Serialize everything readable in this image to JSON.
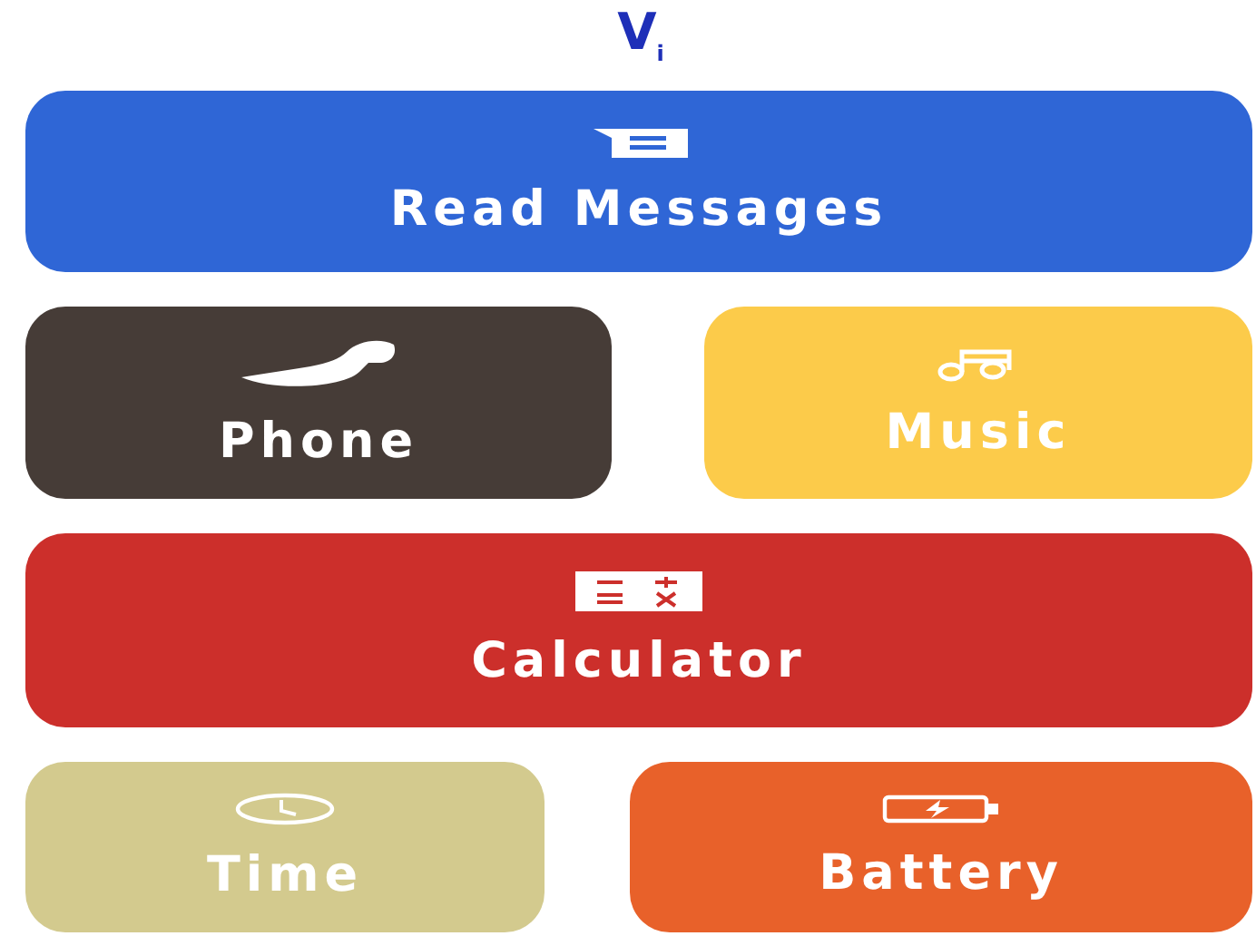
{
  "logo": "V$_{i}$",
  "rows": [
    {
      "tiles": [
        {
          "label": "Read Messages",
          "color": "#2f66d6",
          "kind": "message"
        }
      ]
    },
    {
      "tiles": [
        {
          "label": "Phone",
          "color": "#463c37",
          "kind": "phone"
        },
        {
          "label": "Music",
          "color": "#fccb4a",
          "kind": "music"
        }
      ]
    },
    {
      "tiles": [
        {
          "label": "Calculator",
          "color": "#cc2f2b",
          "kind": "calculator"
        }
      ]
    },
    {
      "tiles": [
        {
          "label": "Time",
          "color": "#d3ca8e",
          "kind": "clock"
        },
        {
          "label": "Battery",
          "color": "#e8612a",
          "kind": "battery"
        }
      ]
    }
  ]
}
